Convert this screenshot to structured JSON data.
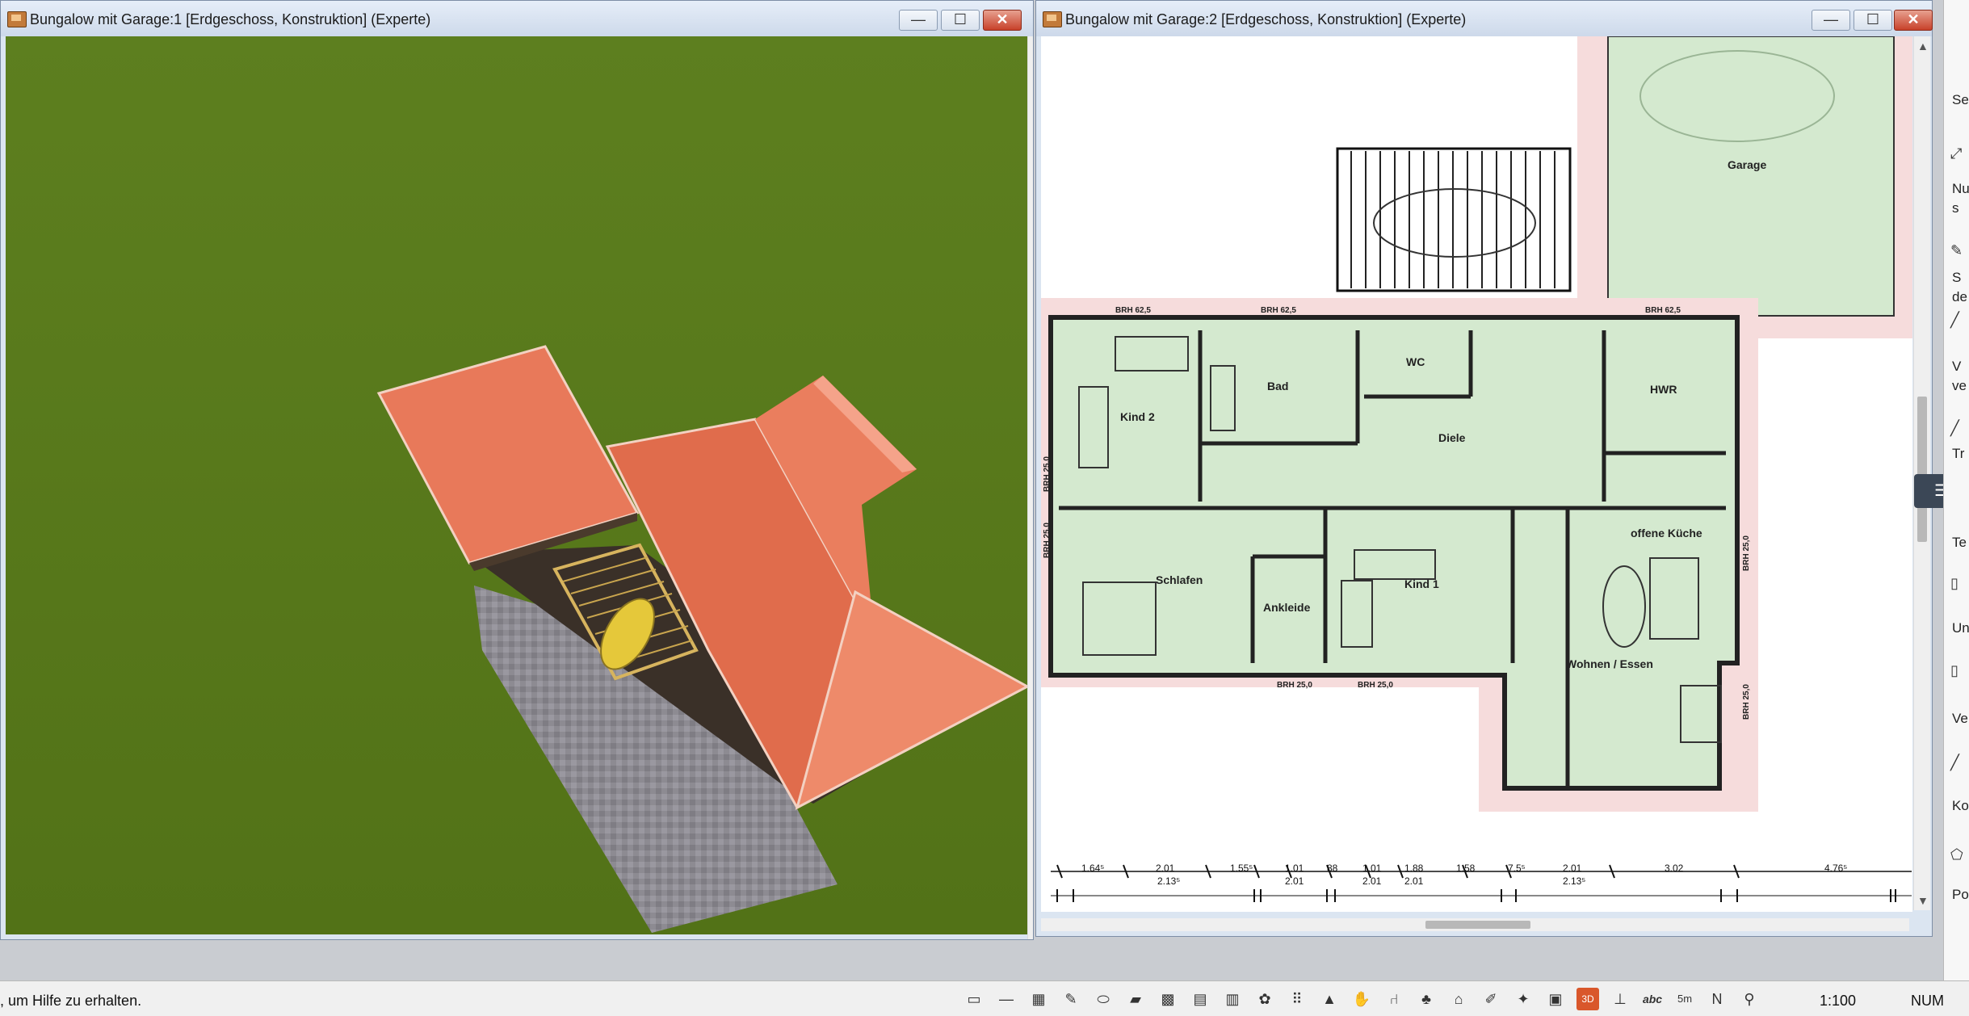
{
  "windows": {
    "left": {
      "title": "Bungalow mit Garage:1 [Erdgeschoss, Konstruktion] (Experte)"
    },
    "right": {
      "title": "Bungalow mit Garage:2 [Erdgeschoss, Konstruktion] (Experte)"
    }
  },
  "window_controls": {
    "minimize": "—",
    "maximize": "☐",
    "close": "✕"
  },
  "floorplan": {
    "rooms": {
      "garage": "Garage",
      "kind2": "Kind 2",
      "bad": "Bad",
      "wc": "WC",
      "diele": "Diele",
      "hwr": "HWR",
      "schlafen": "Schlafen",
      "ankleide": "Ankleide",
      "kind1": "Kind 1",
      "kueche": "offene Küche",
      "wohnen": "Wohnen / Essen"
    },
    "brh_labels": {
      "top1": "BRH 62,5",
      "top2": "BRH 62,5",
      "top3": "BRH 62,5",
      "bottom1": "BRH 25,0",
      "bottom2": "BRH 25,0",
      "left1": "BRH 25,0",
      "left2": "BRH 25,0",
      "right1": "BRH 25,0",
      "right2": "BRH 25,0"
    },
    "dimensions_top": [
      "1.64⁵",
      "2.01",
      "1.55⁵",
      "1.01",
      "88",
      "1.01",
      "1.88",
      "1.58",
      "7.5⁵",
      "2.01",
      "3.02",
      "4.76⁵"
    ],
    "dimensions_bottom": [
      "2.13⁵",
      "2.01",
      "2.01",
      "2.01",
      "2.13⁵"
    ]
  },
  "right_panel": {
    "items": [
      "Se",
      "Nu",
      "s",
      "S",
      "de",
      "V",
      "ve",
      "Tr",
      "Te",
      "Un",
      "Ve",
      "Ko",
      "Po"
    ]
  },
  "status": {
    "help_text": ", um Hilfe zu erhalten.",
    "scale": "1:100",
    "num": "NUM"
  },
  "toolbar_icons": [
    "note-icon",
    "line-icon",
    "grid-icon",
    "pencil-icon",
    "car-icon",
    "terrain-icon",
    "plant-icon",
    "hatch-icon",
    "pattern-icon",
    "stamp-icon",
    "footprint-icon",
    "cone-icon",
    "hand-icon",
    "chair-icon",
    "tree-icon",
    "roof-icon",
    "brush-icon",
    "tool-icon",
    "cube-icon",
    "3d-icon",
    "dimension-icon",
    "abc-icon",
    "5m-icon",
    "north-icon",
    "camera-icon"
  ],
  "colors": {
    "grass": "#587a1e",
    "roof": "#e8795a",
    "paving": "#8c8a90",
    "room_fill": "#d4e9cf",
    "wall_band": "#f6dcdc",
    "close_button": "#c8412a"
  }
}
